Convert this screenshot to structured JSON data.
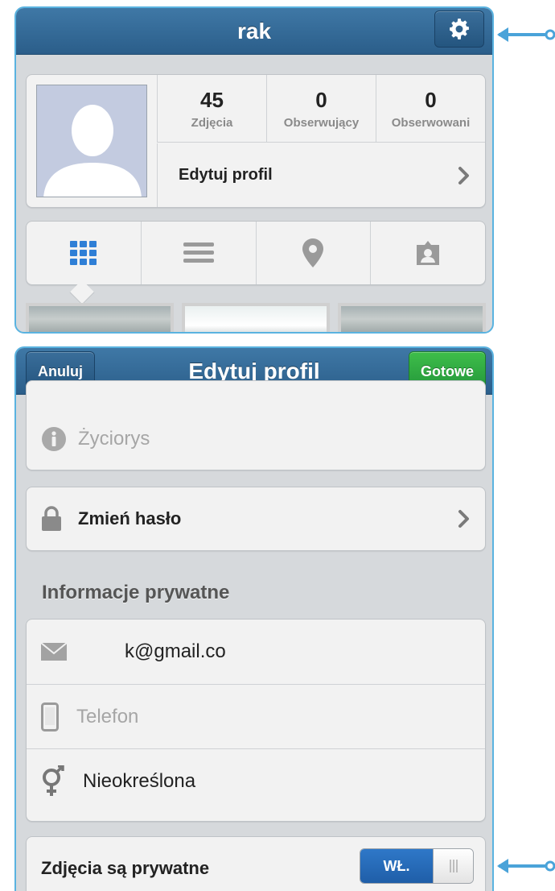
{
  "profile": {
    "username": "rak",
    "stats": [
      {
        "value": "45",
        "label": "Zdjęcia"
      },
      {
        "value": "0",
        "label": "Obserwujący"
      },
      {
        "value": "0",
        "label": "Obserwowani"
      }
    ],
    "edit_profile_label": "Edytuj profil",
    "view_tabs": [
      "grid-icon",
      "list-icon",
      "map-pin-icon",
      "tagged-photos-icon"
    ]
  },
  "edit_profile": {
    "title": "Edytuj profil",
    "cancel_label": "Anuluj",
    "done_label": "Gotowe",
    "bio_placeholder": "Życiorys",
    "change_password_label": "Zmień hasło",
    "private_info_heading": "Informacje prywatne",
    "email_value": "k@gmail.co",
    "phone_placeholder": "Telefon",
    "gender_value": "Nieokreślona",
    "private_photos_label": "Zdjęcia są prywatne",
    "private_photos_toggle_label": "WŁ.",
    "private_photos_on": true
  },
  "colors": {
    "navbar": "#2b5e8a",
    "done_button": "#24973a",
    "toggle_on": "#1f5ea8",
    "callout": "#4aa3d9"
  }
}
